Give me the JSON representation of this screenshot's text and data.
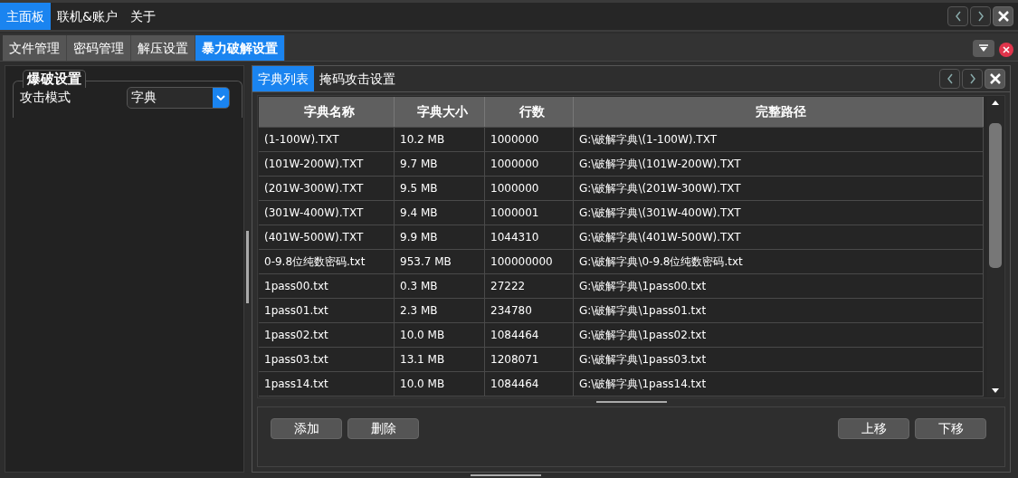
{
  "menu": [
    {
      "label": "主面板",
      "selected": true
    },
    {
      "label": "联机&账户",
      "selected": false
    },
    {
      "label": "关于",
      "selected": false
    }
  ],
  "tabs": [
    {
      "label": "文件管理",
      "selected": false
    },
    {
      "label": "密码管理",
      "selected": false
    },
    {
      "label": "解压设置",
      "selected": false
    },
    {
      "label": "暴力破解设置",
      "selected": true
    }
  ],
  "settings": {
    "title": "爆破设置",
    "attack_mode_label": "攻击模式",
    "attack_mode_value": "字典"
  },
  "sub_tabs": [
    {
      "label": "字典列表",
      "selected": true
    },
    {
      "label": "掩码攻击设置",
      "selected": false
    }
  ],
  "table": {
    "columns": [
      "字典名称",
      "字典大小",
      "行数",
      "完整路径"
    ],
    "rows": [
      [
        "(1-100W).TXT",
        "10.2 MB",
        "1000000",
        "G:\\破解字典\\(1-100W).TXT"
      ],
      [
        "(101W-200W).TXT",
        "9.7 MB",
        "1000000",
        "G:\\破解字典\\(101W-200W).TXT"
      ],
      [
        "(201W-300W).TXT",
        "9.5 MB",
        "1000000",
        "G:\\破解字典\\(201W-300W).TXT"
      ],
      [
        "(301W-400W).TXT",
        "9.4 MB",
        "1000001",
        "G:\\破解字典\\(301W-400W).TXT"
      ],
      [
        "(401W-500W).TXT",
        "9.9 MB",
        "1044310",
        "G:\\破解字典\\(401W-500W).TXT"
      ],
      [
        "0-9.8位纯数密码.txt",
        "953.7 MB",
        "100000000",
        "G:\\破解字典\\0-9.8位纯数密码.txt"
      ],
      [
        "1pass00.txt",
        "0.3 MB",
        "27222",
        "G:\\破解字典\\1pass00.txt"
      ],
      [
        "1pass01.txt",
        "2.3 MB",
        "234780",
        "G:\\破解字典\\1pass01.txt"
      ],
      [
        "1pass02.txt",
        "10.0 MB",
        "1084464",
        "G:\\破解字典\\1pass02.txt"
      ],
      [
        "1pass03.txt",
        "13.1 MB",
        "1208071",
        "G:\\破解字典\\1pass03.txt"
      ],
      [
        "1pass14.txt",
        "10.0 MB",
        "1084464",
        "G:\\破解字典\\1pass14.txt"
      ]
    ]
  },
  "buttons_left": [
    "添加",
    "删除"
  ],
  "buttons_right": [
    "上移",
    "下移"
  ]
}
